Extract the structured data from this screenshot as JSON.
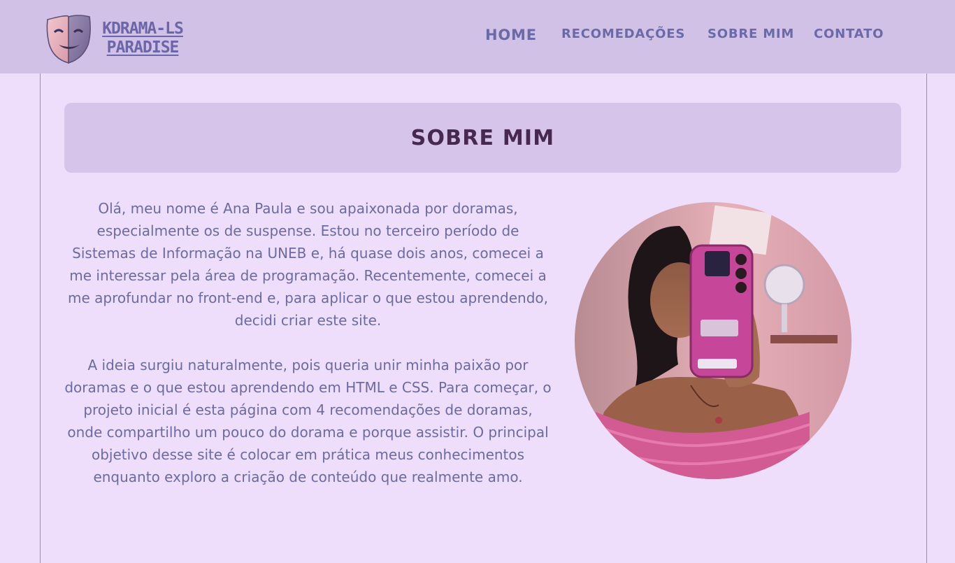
{
  "logo": {
    "line1": "KDRAMA-LS",
    "line2": "PARADISE"
  },
  "nav": {
    "home": "HOME",
    "recommendations": "RECOMEDAÇÕES",
    "about": "SOBRE MIM",
    "contact": "CONTATO"
  },
  "main": {
    "title": "SOBRE MIM",
    "paragraphs": [
      "Olá, meu nome é Ana Paula e sou apaixonada por doramas, especialmente os de suspense. Estou no terceiro período de Sistemas de Informação na UNEB e, há quase dois anos, comecei a me interessar pela área de programação. Recentemente, comecei a me aprofundar no front-end e, para aplicar o que estou aprendendo, decidi criar este site.",
      "A ideia surgiu naturalmente, pois queria unir minha paixão por doramas e o que estou aprendendo em HTML e CSS. Para começar, o projeto inicial é esta página com 4 recomendações de doramas, onde compartilho um pouco do dorama e porque assistir. O principal objetivo desse site é colocar em prática meus conhecimentos enquanto exploro a criação de conteúdo que realmente amo."
    ]
  },
  "colors": {
    "header_bg": "#d2c1e6",
    "page_bg": "#efdefb",
    "nav_text": "#6a6aa8",
    "title_box_bg": "#d6c4ea",
    "title_text": "#47284f",
    "body_text": "#6b6aa2"
  },
  "icons": {
    "logo": "theater-mask-icon"
  }
}
